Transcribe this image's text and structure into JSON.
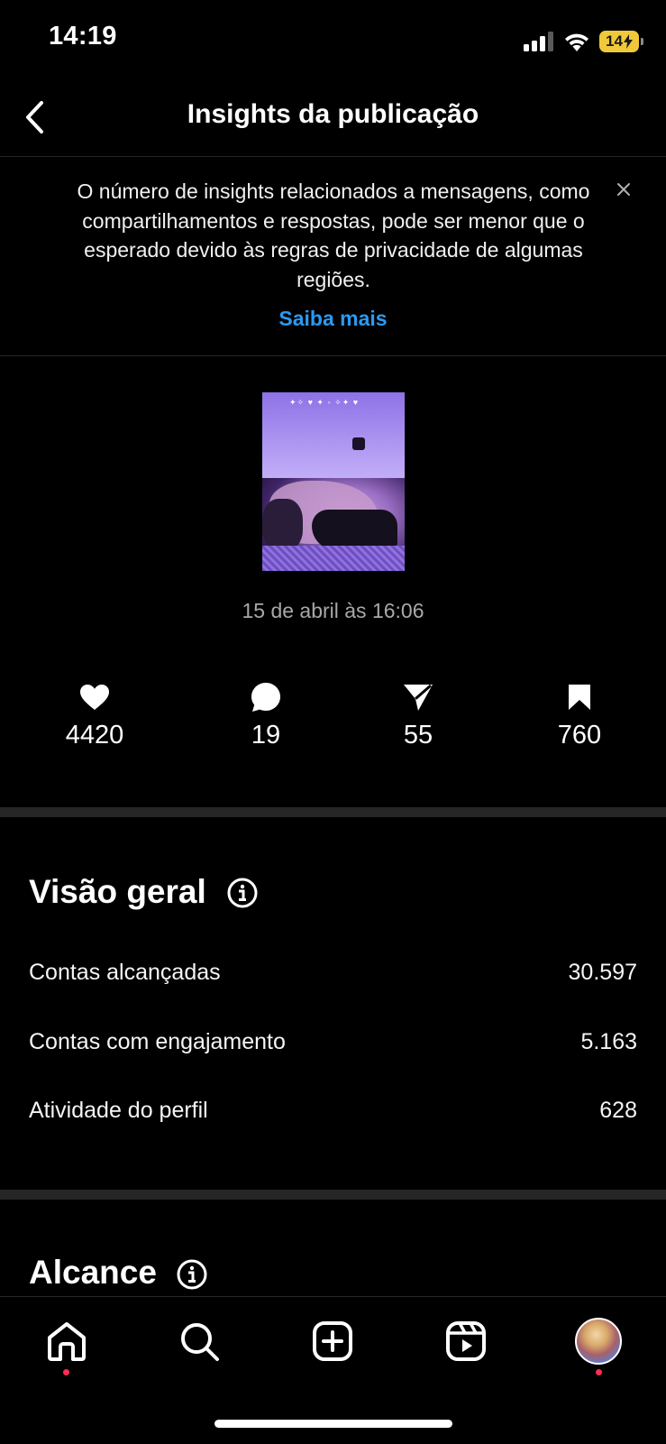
{
  "status_bar": {
    "time": "14:19",
    "battery": "14"
  },
  "header": {
    "title": "Insights da publicação"
  },
  "notice": {
    "text": "O número de insights relacionados a mensagens, como compartilhamentos e respostas, pode ser menor que o esperado devido às regras de privacidade de algumas regiões.",
    "link": "Saiba mais"
  },
  "post": {
    "date": "15 de abril às 16:06"
  },
  "stats": {
    "likes": "4420",
    "comments": "19",
    "shares": "55",
    "saves": "760"
  },
  "overview": {
    "title": "Visão geral",
    "rows": [
      {
        "label": "Contas alcançadas",
        "value": "30.597"
      },
      {
        "label": "Contas com engajamento",
        "value": "5.163"
      },
      {
        "label": "Atividade do perfil",
        "value": "628"
      }
    ]
  },
  "reach": {
    "title": "Alcance"
  },
  "colors": {
    "accent": "#2b9af3",
    "notification": "#ff2d55",
    "battery": "#f0c93a"
  }
}
